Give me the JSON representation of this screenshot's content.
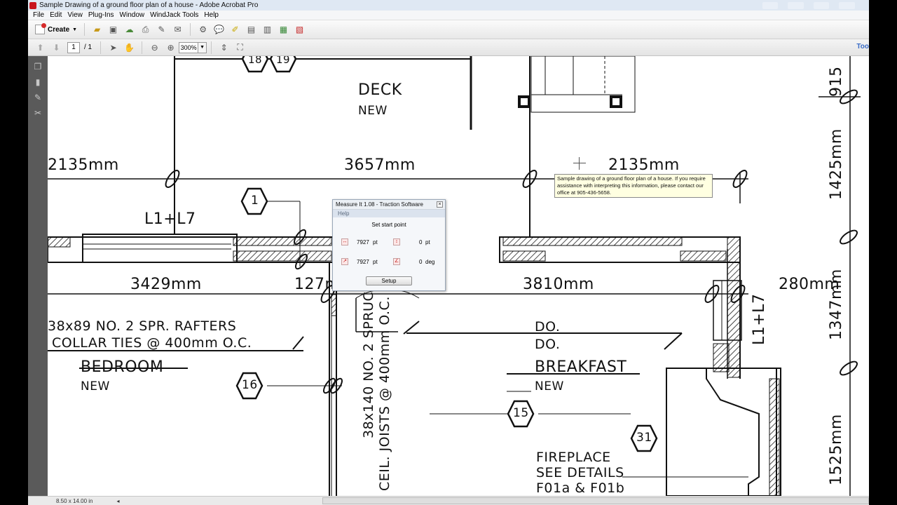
{
  "window": {
    "title": "Sample Drawing of a ground floor plan of a house - Adobe Acrobat Pro",
    "background_tabs": [
      "",
      "",
      "",
      ""
    ]
  },
  "menu": [
    "File",
    "Edit",
    "View",
    "Plug-Ins",
    "Window",
    "WindJack Tools",
    "Help"
  ],
  "toolbar": {
    "create_label": "Create",
    "icons": [
      "open-icon",
      "save-icon",
      "cloud-icon",
      "print-icon",
      "edit-icon",
      "email-icon",
      "settings-icon",
      "comment-icon",
      "stamp-icon",
      "tool1-icon",
      "tool2-icon",
      "tool3-icon",
      "tool4-icon"
    ]
  },
  "nav_toolbar": {
    "page_current": "1",
    "page_total": "/ 1",
    "zoom": "300%",
    "tools_label": "Too"
  },
  "drawing": {
    "deck": "DECK",
    "deck_new": "NEW",
    "dim_2135_left": "2135mm",
    "dim_3657": "3657mm",
    "dim_2135_right": "2135mm",
    "dim_3429": "3429mm",
    "dim_127": "127mm",
    "dim_3810": "3810mm",
    "dim_280": "280mm",
    "dim_1425": "1425mm",
    "dim_1347": "1347mm",
    "dim_1525": "1525mm",
    "dim_915": "915",
    "lintel_left": "L1+L7",
    "lintel_right": "L1+L7",
    "rafters": "38x89 NO. 2 SPR. RAFTERS",
    "collar": "COLLAR TIES @ 400mm O.C.",
    "bedroom": "BEDROOM",
    "bedroom_new": "NEW",
    "do1": "DO.",
    "do2": "DO.",
    "breakfast": "BREAKFAST",
    "breakfast_new": "NEW",
    "fireplace": "FIREPLACE",
    "see_details": "SEE DETAILS",
    "f01": "F01a & F01b",
    "joists": "38x140 NO. 2 SPRUCE",
    "joists2": "CEIL. JOISTS @ 400mm O.C.",
    "tag_18": "18",
    "tag_19": "19",
    "tag_1": "1",
    "tag_16": "16",
    "tag_15": "15",
    "tag_31": "31"
  },
  "measure_dialog": {
    "title": "Measure It 1.08 - Traction Software",
    "menu_help": "Help",
    "prompt": "Set start point",
    "dx_value": "7927",
    "dx_unit": "pt",
    "dy_value": "0",
    "dy_unit": "pt",
    "dist_value": "7927",
    "dist_unit": "pt",
    "angle_value": "0",
    "angle_unit": "deg",
    "setup_label": "Setup"
  },
  "tooltip": "Sample drawing of a ground floor plan of a house. If you require assistance with interpreting this information, please contact our office at 905-436-5658.",
  "status": {
    "page_size": "8.50 x 14.00 in"
  }
}
